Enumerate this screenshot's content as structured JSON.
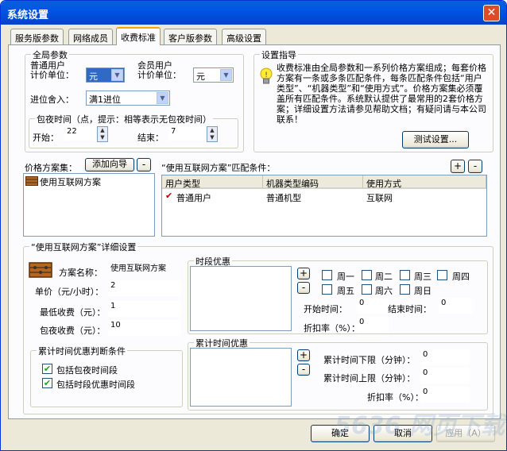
{
  "title": "系统设置",
  "tabs": [
    "服务版参数",
    "网络成员",
    "收费标准",
    "客户版参数",
    "高级设置"
  ],
  "global": {
    "legend": "全局参数",
    "normal_unit_label": "普通用户\n计价单位：",
    "normal_unit_value": "元",
    "member_unit_label": "会员用户\n计价单位：",
    "member_unit_value": "元",
    "rounding_label": "进位舍入：",
    "rounding_value": "满1进位",
    "overnight_legend": "包夜时间（点，提示：相等表示无包夜时间）",
    "start_label": "开始：",
    "start_value": "22",
    "end_label": "结束：",
    "end_value": "7"
  },
  "guide": {
    "legend": "设置指导",
    "text": "收费标准由全局参数和一系列价格方案组成；每套价格方案有一条或多条匹配条件，每条匹配条件包括“用户类型”、“机器类型”和“使用方式”。价格方案集必须覆盖所有匹配条件。系统默认提供了最常用的2套价格方案；详细设置方法请参见帮助文档；有疑问请与本公司联系！",
    "test_button": "测试设置..."
  },
  "schemes": {
    "label": "价格方案集：",
    "wizard_button": "添加向导",
    "minus": "-",
    "plus": "+",
    "items": [
      "使用互联网方案"
    ]
  },
  "match": {
    "label": "“使用互联网方案”匹配条件：",
    "headers": [
      "用户类型",
      "机器类型编码",
      "使用方式"
    ],
    "rows": [
      [
        "普通用户",
        "普通机型",
        "互联网"
      ]
    ]
  },
  "detail": {
    "legend": "“使用互联网方案”详细设置",
    "name_label": "方案名称：",
    "name_value": "使用互联网方案",
    "price_label": "单价（元/小时）：",
    "price_value": "2",
    "min_label": "最低收费（元）：",
    "min_value": "1",
    "overnight_label": "包夜收费（元）：",
    "overnight_value": "10",
    "cond_legend": "累计时间优惠判断条件",
    "cond1": "包括包夜时间段",
    "cond2": "包括时段优惠时间段",
    "cond1_checked": true,
    "cond2_checked": true
  },
  "period": {
    "legend": "时段优惠",
    "days": [
      "周一",
      "周二",
      "周三",
      "周四",
      "周五",
      "周六",
      "周日"
    ],
    "start_label": "开始时间：",
    "start_value": "0",
    "end_label": "结束时间：",
    "end_value": "0",
    "rate_label": "折扣率（%）：",
    "rate_value": "0"
  },
  "accum": {
    "legend": "累计时间优惠",
    "lower_label": "累计时间下限（分钟）：",
    "lower_value": "0",
    "upper_label": "累计时间上限（分钟）：",
    "upper_value": "0",
    "rate_label": "折扣率（%）：",
    "rate_value": "0"
  },
  "footer": {
    "ok": "确定",
    "cancel": "取消",
    "apply": "应用（A）"
  },
  "watermark": "5636 网页下载"
}
